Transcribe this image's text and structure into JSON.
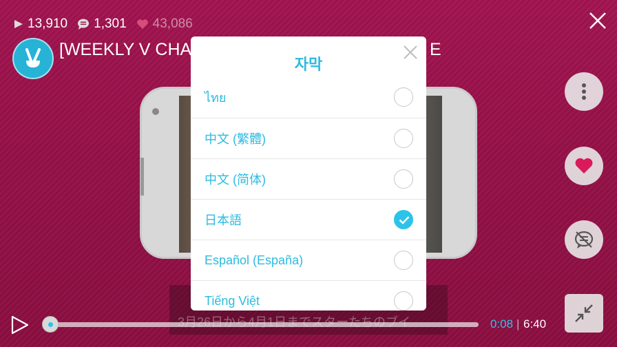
{
  "stats": {
    "views": "13,910",
    "comments": "1,301",
    "likes": "43,086"
  },
  "video": {
    "title": "[WEEKLY V CHA",
    "title_tail": "E",
    "subtitle": "3月26日から4月1日までスターたちのブイ"
  },
  "dialog": {
    "title": "자막",
    "options": [
      {
        "label": "ไทย",
        "checked": false
      },
      {
        "label": "中文 (繁體)",
        "checked": false
      },
      {
        "label": "中文 (简体)",
        "checked": false
      },
      {
        "label": "日本語",
        "checked": true
      },
      {
        "label": "Español (España)",
        "checked": false
      },
      {
        "label": "Tiếng Việt",
        "checked": false
      }
    ]
  },
  "player": {
    "current_time": "0:08",
    "separator": "|",
    "total_time": "6:40",
    "progress": 0.02
  },
  "colors": {
    "accent": "#2cc3e8",
    "background": "#9a1049"
  },
  "icons": [
    "play-icon",
    "comment-icon",
    "heart-icon",
    "close-icon",
    "more-icon",
    "no-chat-icon",
    "shrink-icon",
    "check-icon",
    "v-live-logo"
  ]
}
